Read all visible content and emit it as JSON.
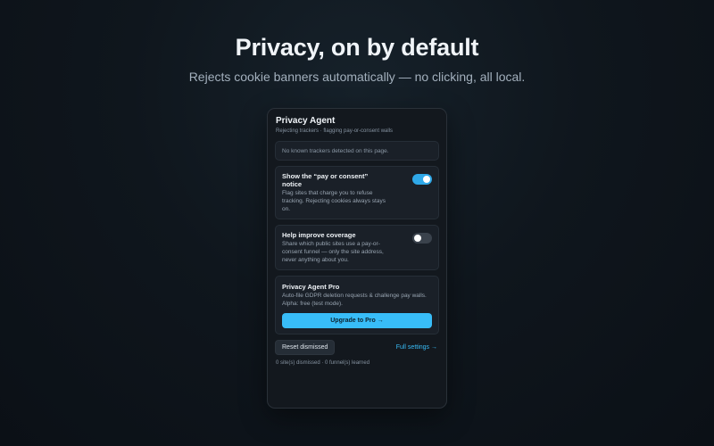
{
  "hero": {
    "title": "Privacy, on by default",
    "subtitle": "Rejects cookie banners automatically — no clicking, all local."
  },
  "popup": {
    "title": "Privacy Agent",
    "subtitle": "Rejecting trackers · flagging pay-or-consent walls",
    "tracker_status": "No known trackers detected on this page.",
    "toggles": [
      {
        "title": "Show the “pay or consent” notice",
        "description": "Flag sites that charge you to refuse tracking. Rejecting cookies always stays on.",
        "state": "on"
      },
      {
        "title": "Help improve coverage",
        "description": "Share which public sites use a pay-or-consent funnel — only the site address, never anything about you.",
        "state": "off"
      }
    ],
    "pro": {
      "title": "Privacy Agent Pro",
      "description": "Auto-file GDPR deletion requests & challenge pay walls. Alpha: free (test mode).",
      "button_label": "Upgrade to Pro →"
    },
    "reset_label": "Reset dismissed",
    "full_settings_label": "Full settings →",
    "stats": "0 site(s) dismissed · 0 funnel(s) learned"
  },
  "colors": {
    "accent": "#38bdf8",
    "toggle_on": "#2fa8e8",
    "toggle_off": "#3a424c"
  }
}
